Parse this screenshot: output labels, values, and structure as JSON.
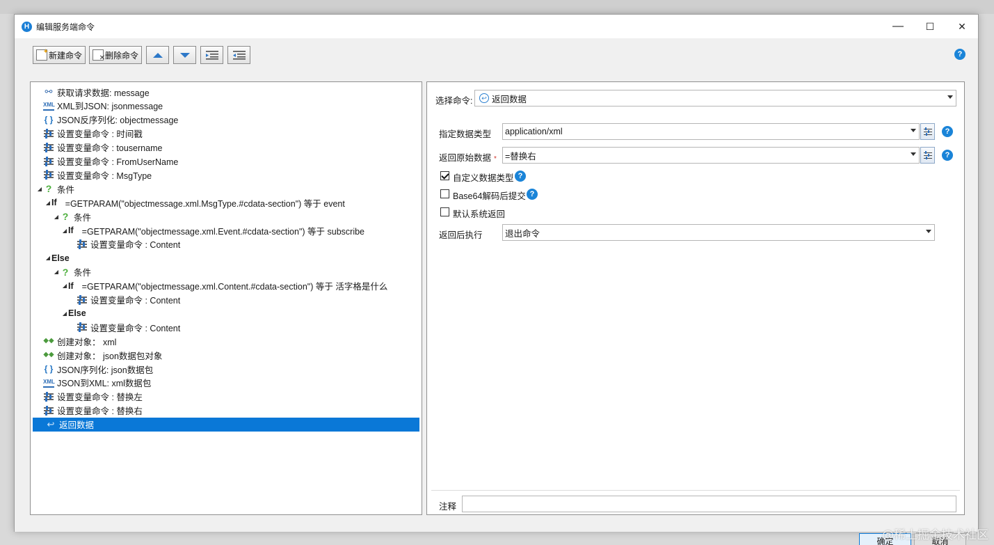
{
  "window": {
    "title": "编辑服务端命令",
    "app_icon_letter": "H",
    "minimize": "—",
    "maximize": "☐",
    "close": "✕"
  },
  "toolbar": {
    "new_label": "新建命令",
    "delete_label": "删除命令"
  },
  "tree": [
    {
      "indent": 0,
      "expander": "",
      "icon": "branch",
      "label": "获取请求数据: message",
      "bold": false
    },
    {
      "indent": 0,
      "expander": "",
      "icon": "xml",
      "label": "XML到JSON: jsonmessage",
      "bold": false
    },
    {
      "indent": 0,
      "expander": "",
      "icon": "brace",
      "label": "JSON反序列化: objectmessage",
      "bold": false
    },
    {
      "indent": 0,
      "expander": "",
      "icon": "set",
      "label": "设置变量命令 : 时间戳",
      "bold": false
    },
    {
      "indent": 0,
      "expander": "",
      "icon": "set",
      "label": "设置变量命令 : tousername",
      "bold": false
    },
    {
      "indent": 0,
      "expander": "",
      "icon": "set",
      "label": "设置变量命令 : FromUserName",
      "bold": false
    },
    {
      "indent": 0,
      "expander": "",
      "icon": "set",
      "label": "设置变量命令 : MsgType",
      "bold": false
    },
    {
      "indent": 0,
      "expander": "◢",
      "icon": "q",
      "label": "条件",
      "bold": false
    },
    {
      "indent": 1,
      "expander": "◢",
      "icon": "",
      "prefix": "If",
      "label": "=GETPARAM(\"objectmessage.xml.MsgType.#cdata-section\") 等于 event",
      "bold": false
    },
    {
      "indent": 2,
      "expander": "◢",
      "icon": "q",
      "label": "条件",
      "bold": false
    },
    {
      "indent": 3,
      "expander": "◢",
      "icon": "",
      "prefix": "If",
      "label": "=GETPARAM(\"objectmessage.xml.Event.#cdata-section\") 等于 subscribe",
      "bold": false
    },
    {
      "indent": 4,
      "expander": "",
      "icon": "set",
      "label": "设置变量命令 : Content",
      "bold": false
    },
    {
      "indent": 1,
      "expander": "◢",
      "icon": "",
      "prefix": "Else",
      "label": "",
      "bold": true
    },
    {
      "indent": 2,
      "expander": "◢",
      "icon": "q",
      "label": "条件",
      "bold": false
    },
    {
      "indent": 3,
      "expander": "◢",
      "icon": "",
      "prefix": "If",
      "label": "=GETPARAM(\"objectmessage.xml.Content.#cdata-section\") 等于 活字格是什么",
      "bold": false
    },
    {
      "indent": 4,
      "expander": "",
      "icon": "set",
      "label": "设置变量命令 : Content",
      "bold": false
    },
    {
      "indent": 3,
      "expander": "◢",
      "icon": "",
      "prefix": "Else",
      "label": "",
      "bold": true
    },
    {
      "indent": 4,
      "expander": "",
      "icon": "set",
      "label": "设置变量命令 : Content",
      "bold": false
    },
    {
      "indent": 0,
      "expander": "",
      "icon": "obj",
      "label": "创建对象： xml",
      "bold": false
    },
    {
      "indent": 0,
      "expander": "",
      "icon": "obj",
      "label": "创建对象： json数据包对象",
      "bold": false
    },
    {
      "indent": 0,
      "expander": "",
      "icon": "brace",
      "label": "JSON序列化: json数据包",
      "bold": false
    },
    {
      "indent": 0,
      "expander": "",
      "icon": "xml",
      "label": "JSON到XML: xml数据包",
      "bold": false
    },
    {
      "indent": 0,
      "expander": "",
      "icon": "set",
      "label": "设置变量命令 : 替换左",
      "bold": false
    },
    {
      "indent": 0,
      "expander": "",
      "icon": "set",
      "label": "设置变量命令 : 替换右",
      "bold": false
    },
    {
      "indent": 0,
      "expander": "",
      "icon": "ret",
      "label": "返回数据",
      "bold": false,
      "selected": true
    }
  ],
  "form": {
    "select_command_label": "选择命令:",
    "select_command_value": "返回数据",
    "data_type_label": "指定数据类型",
    "data_type_value": "application/xml",
    "raw_data_label": "返回原始数据",
    "raw_data_required": "*",
    "raw_data_value": "=替换右",
    "custom_type_label": "自定义数据类型",
    "custom_type_checked": true,
    "base64_label": "Base64解码后提交",
    "base64_checked": false,
    "default_return_label": "默认系统返回",
    "default_return_checked": false,
    "after_return_label": "返回后执行",
    "after_return_value": "退出命令",
    "note_label": "注释",
    "note_value": ""
  },
  "footer": {
    "ok_label": "确定",
    "cancel_label": "取消"
  },
  "watermark": "@稀土掘金技术社区",
  "help_glyph": "?",
  "colors": {
    "accent": "#0a78d7",
    "help": "#1a84d8",
    "selected_row": "#0a78d7"
  }
}
